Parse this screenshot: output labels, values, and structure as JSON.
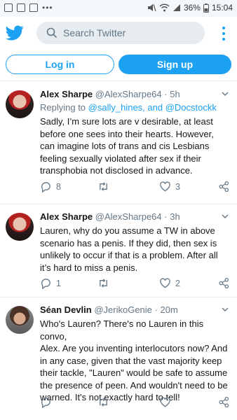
{
  "status_bar": {
    "battery": "36%",
    "time": "15:04",
    "icons": [
      "image-icon",
      "calendar-icon",
      "message-icon",
      "more-icon",
      "mute-icon",
      "wifi-icon",
      "signal-icon",
      "battery-icon"
    ]
  },
  "header": {
    "search_placeholder": "Search Twitter",
    "icons": [
      "twitter-bird-icon",
      "search-icon",
      "more-vertical-icon"
    ]
  },
  "auth": {
    "login_label": "Log in",
    "signup_label": "Sign up"
  },
  "colors": {
    "accent": "#1da1f2",
    "text_primary": "#14171a",
    "text_secondary": "#657786",
    "divider": "#e6ecf0"
  },
  "tweets": [
    {
      "name": "Alex Sharpe",
      "handle": "@AlexSharpe64",
      "sep": "·",
      "time": "5h",
      "replying_prefix": "Replying to",
      "replying_users": "@sally_hines, and @Docstockk",
      "lines": [
        "Sadly, I’m sure lots are v desirable, at least",
        "before one sees into their hearts. However,",
        "can imagine lots of trans and cis Lesbians",
        "feeling sexually violated after sex if their",
        "transphobia not disclosed in advance."
      ],
      "replies": "8",
      "retweets": "",
      "likes": "3"
    },
    {
      "name": "Alex Sharpe",
      "handle": "@AlexSharpe64",
      "sep": "·",
      "time": "3h",
      "lines": [
        "Lauren, why do you assume a TW in above",
        "scenario has a penis. If they did, then sex is",
        "unlikely to occur if that is a problem. After all",
        "it’s hard to miss a penis."
      ],
      "replies": "1",
      "retweets": "",
      "likes": "2"
    },
    {
      "name": "Séan Devlin",
      "handle": "@JerikoGenie",
      "sep": "·",
      "time": "20m",
      "lines": [
        "Who's Lauren? There's no Lauren in this convo,",
        "Alex. Are you inventing interlocutors now? And",
        "in any case, given that the vast majority keep",
        "their tackle, \"Lauren\" would be safe to assume",
        "the presence of peen.  And wouldn't need to be",
        "warned. It's not exactly hard to tell!"
      ],
      "replies": "",
      "retweets": "",
      "likes": ""
    }
  ]
}
